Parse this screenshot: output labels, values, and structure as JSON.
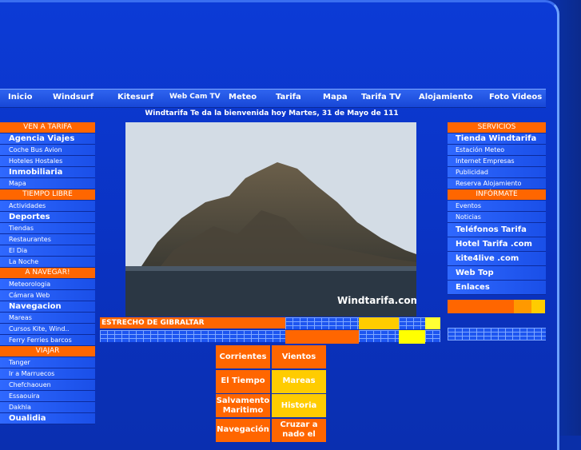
{
  "nav": [
    "Inicio",
    "Windsurf",
    "Kitesurf",
    "Web Cam TV",
    "Meteo",
    "Tarifa",
    "Mapa",
    "Tarifa TV",
    "Alojamiento",
    "Foto Videos"
  ],
  "welcome": "Windtarifa Te da la bienvenida hoy  Martes, 31 de Mayo de 111",
  "left": [
    {
      "t": "hdr",
      "label": "VEN A TARIFA"
    },
    {
      "t": "big",
      "label": "Agencia Viajes"
    },
    {
      "t": "item",
      "label": "Coche Bus Avion"
    },
    {
      "t": "item",
      "label": "Hoteles Hostales"
    },
    {
      "t": "big",
      "label": "Inmobiliaria"
    },
    {
      "t": "item",
      "label": "Mapa"
    },
    {
      "t": "hdr",
      "label": "TIEMPO LIBRE"
    },
    {
      "t": "item",
      "label": "Actividades"
    },
    {
      "t": "big",
      "label": "Deportes"
    },
    {
      "t": "item",
      "label": "Tiendas"
    },
    {
      "t": "item",
      "label": "Restaurantes"
    },
    {
      "t": "item",
      "label": "El Dia"
    },
    {
      "t": "item",
      "label": "La Noche"
    },
    {
      "t": "hdr",
      "label": "A NAVEGAR!"
    },
    {
      "t": "item",
      "label": "Meteorologia"
    },
    {
      "t": "item",
      "label": "Cámara Web"
    },
    {
      "t": "big",
      "label": "Navegacion"
    },
    {
      "t": "item",
      "label": "Mareas"
    },
    {
      "t": "item",
      "label": "Cursos Kite, Wind.."
    },
    {
      "t": "item",
      "label": "Ferry Ferries barcos"
    },
    {
      "t": "hdr",
      "label": "VIAJAR"
    },
    {
      "t": "item",
      "label": "Tanger"
    },
    {
      "t": "item",
      "label": "Ir a Marruecos"
    },
    {
      "t": "item",
      "label": "Chefchaouen"
    },
    {
      "t": "item",
      "label": "Essaouira"
    },
    {
      "t": "item",
      "label": "Dakhla"
    },
    {
      "t": "big",
      "label": "Oualidia"
    }
  ],
  "right": [
    {
      "t": "hdr",
      "label": "SERVICIOS"
    },
    {
      "t": "big",
      "label": "Tienda Windtarifa"
    },
    {
      "t": "item",
      "label": "Estación Meteo"
    },
    {
      "t": "item",
      "label": "Internet Empresas"
    },
    {
      "t": "item",
      "label": "Publicidad"
    },
    {
      "t": "item",
      "label": "Reserva Alojamiento"
    },
    {
      "t": "hdr",
      "label": "INFÓRMATE"
    },
    {
      "t": "item",
      "label": "Eventos"
    },
    {
      "t": "item",
      "label": "Noticias"
    },
    {
      "t": "tall",
      "label": "Teléfonos Tarifa"
    },
    {
      "t": "tall",
      "label": "Hotel Tarifa .com"
    },
    {
      "t": "tall",
      "label": "kite4live .com"
    },
    {
      "t": "tall",
      "label": "Web Top"
    },
    {
      "t": "tall",
      "label": "Enlaces"
    }
  ],
  "photo_watermark": "Windtarifa.com",
  "estrecho": "ESTRECHO DE GIBRALTAR",
  "tiles": [
    {
      "label": "Corrientes",
      "color": "or"
    },
    {
      "label": "Vientos",
      "color": "or"
    },
    {
      "label": "El Tiempo",
      "color": "or"
    },
    {
      "label": "Mareas",
      "color": "ye"
    },
    {
      "label": "Salvamento Maritimo",
      "color": "or"
    },
    {
      "label": "Historia",
      "color": "ye"
    },
    {
      "label": "Navegación",
      "color": "or"
    },
    {
      "label": "Cruzar a nado el",
      "color": "or"
    }
  ]
}
